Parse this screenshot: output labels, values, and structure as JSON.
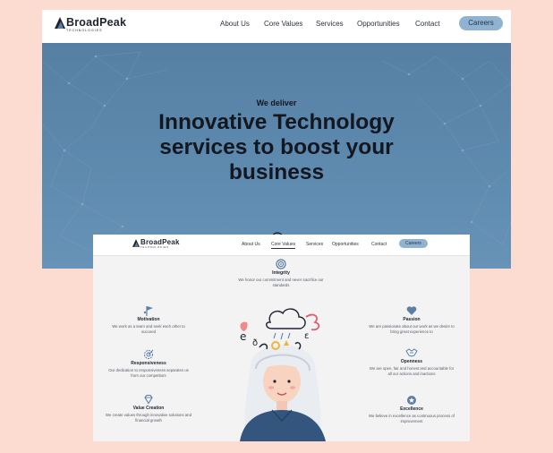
{
  "screens": [
    {
      "logo": {
        "brand": "BroadPeak",
        "tagline": "TECHNOLOGIES"
      },
      "nav": [
        "About Us",
        "Core Values",
        "Services",
        "Opportunities",
        "Contact"
      ],
      "cta": "Careers",
      "hero": {
        "eyebrow": "We deliver",
        "headline": "Innovative Technology services to boost your business"
      }
    },
    {
      "logo": {
        "brand": "BroadPeak",
        "tagline": "TECHNOLOGIES"
      },
      "nav": [
        "About Us",
        "Core Values",
        "Services",
        "Opportunities",
        "Contact"
      ],
      "active_nav": "Core Values",
      "cta": "Careers",
      "values": [
        {
          "icon": "target-icon",
          "title": "Integrity",
          "desc": "We honor our commitment and never sacrifice our standards"
        },
        {
          "icon": "flag-icon",
          "title": "Motivation",
          "desc": "We work as a team and seek each other to succeed"
        },
        {
          "icon": "dart-board-icon",
          "title": "Responsiveness",
          "desc": "Our dedication to responsiveness separates us from our competitors"
        },
        {
          "icon": "diamond-icon",
          "title": "Value Creation",
          "desc": "We create values through innovative solutions and financial growth"
        },
        {
          "icon": "heart-icon",
          "title": "Passion",
          "desc": "We are passionate about our work as we desire to bring great experience to"
        },
        {
          "icon": "handshake-icon",
          "title": "Openness",
          "desc": "We are open, fair and honest and accountable for all our actions and inactions"
        },
        {
          "icon": "badge-icon",
          "title": "Excellence",
          "desc": "We believe in excellence as continuous process of improvement"
        }
      ]
    }
  ],
  "colors": {
    "background": "#fcdcd0",
    "hero_blue": "#5f8bb0",
    "cta_blue": "#8fb3d1",
    "icon_blue": "#5b7fa6",
    "dark_text": "#1f2330"
  }
}
